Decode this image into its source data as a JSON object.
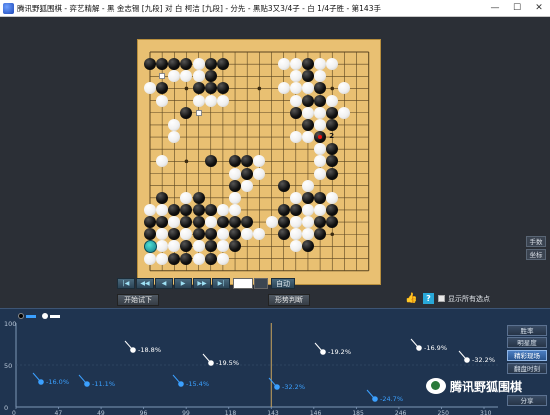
{
  "window": {
    "title": "腾讯野狐围棋 - 弈艺精解 - 黑 金志锡 [九段] 对 白 柯洁 [九段] - 分先 - 黑贴3又3/4子 - 白 1/4子胜 - 第143手",
    "minimize": "—",
    "maximize": "☐",
    "close": "✕"
  },
  "board": {
    "size": 19,
    "stones": [
      {
        "c": "b",
        "x": 0,
        "y": 1
      },
      {
        "c": "b",
        "x": 1,
        "y": 1
      },
      {
        "c": "b",
        "x": 2,
        "y": 1
      },
      {
        "c": "b",
        "x": 3,
        "y": 1
      },
      {
        "c": "w",
        "x": 4,
        "y": 1
      },
      {
        "c": "b",
        "x": 5,
        "y": 1
      },
      {
        "c": "b",
        "x": 6,
        "y": 1
      },
      {
        "c": "w",
        "x": 11,
        "y": 1
      },
      {
        "c": "w",
        "x": 12,
        "y": 1
      },
      {
        "c": "b",
        "x": 13,
        "y": 1
      },
      {
        "c": "w",
        "x": 14,
        "y": 1
      },
      {
        "c": "w",
        "x": 15,
        "y": 1
      },
      {
        "c": "w",
        "x": 2,
        "y": 2
      },
      {
        "c": "w",
        "x": 3,
        "y": 2
      },
      {
        "c": "w",
        "x": 4,
        "y": 2
      },
      {
        "c": "b",
        "x": 5,
        "y": 2
      },
      {
        "c": "w",
        "x": 12,
        "y": 2
      },
      {
        "c": "b",
        "x": 13,
        "y": 2
      },
      {
        "c": "w",
        "x": 14,
        "y": 2
      },
      {
        "c": "w",
        "x": 0,
        "y": 3
      },
      {
        "c": "b",
        "x": 1,
        "y": 3
      },
      {
        "c": "b",
        "x": 4,
        "y": 3
      },
      {
        "c": "b",
        "x": 5,
        "y": 3
      },
      {
        "c": "b",
        "x": 6,
        "y": 3
      },
      {
        "c": "w",
        "x": 11,
        "y": 3
      },
      {
        "c": "w",
        "x": 12,
        "y": 3
      },
      {
        "c": "w",
        "x": 13,
        "y": 3
      },
      {
        "c": "b",
        "x": 14,
        "y": 3
      },
      {
        "c": "w",
        "x": 16,
        "y": 3
      },
      {
        "c": "w",
        "x": 1,
        "y": 4
      },
      {
        "c": "w",
        "x": 4,
        "y": 4
      },
      {
        "c": "w",
        "x": 5,
        "y": 4
      },
      {
        "c": "w",
        "x": 6,
        "y": 4
      },
      {
        "c": "w",
        "x": 12,
        "y": 4
      },
      {
        "c": "b",
        "x": 13,
        "y": 4
      },
      {
        "c": "b",
        "x": 14,
        "y": 4
      },
      {
        "c": "w",
        "x": 15,
        "y": 4
      },
      {
        "c": "b",
        "x": 3,
        "y": 5
      },
      {
        "c": "b",
        "x": 12,
        "y": 5
      },
      {
        "c": "w",
        "x": 13,
        "y": 5
      },
      {
        "c": "w",
        "x": 14,
        "y": 5
      },
      {
        "c": "b",
        "x": 15,
        "y": 5
      },
      {
        "c": "w",
        "x": 16,
        "y": 5
      },
      {
        "c": "w",
        "x": 2,
        "y": 6
      },
      {
        "c": "b",
        "x": 13,
        "y": 6
      },
      {
        "c": "w",
        "x": 14,
        "y": 6
      },
      {
        "c": "b",
        "x": 15,
        "y": 6
      },
      {
        "c": "w",
        "x": 2,
        "y": 7
      },
      {
        "c": "w",
        "x": 12,
        "y": 7
      },
      {
        "c": "w",
        "x": 13,
        "y": 7
      },
      {
        "c": "b",
        "x": 14,
        "y": 7
      },
      {
        "c": "w",
        "x": 14,
        "y": 8
      },
      {
        "c": "b",
        "x": 15,
        "y": 8
      },
      {
        "c": "w",
        "x": 1,
        "y": 9
      },
      {
        "c": "b",
        "x": 5,
        "y": 9
      },
      {
        "c": "b",
        "x": 7,
        "y": 9
      },
      {
        "c": "b",
        "x": 8,
        "y": 9
      },
      {
        "c": "w",
        "x": 9,
        "y": 9
      },
      {
        "c": "w",
        "x": 14,
        "y": 9
      },
      {
        "c": "b",
        "x": 15,
        "y": 9
      },
      {
        "c": "w",
        "x": 7,
        "y": 10
      },
      {
        "c": "b",
        "x": 8,
        "y": 10
      },
      {
        "c": "w",
        "x": 9,
        "y": 10
      },
      {
        "c": "w",
        "x": 14,
        "y": 10
      },
      {
        "c": "b",
        "x": 15,
        "y": 10
      },
      {
        "c": "b",
        "x": 7,
        "y": 11
      },
      {
        "c": "w",
        "x": 8,
        "y": 11
      },
      {
        "c": "b",
        "x": 11,
        "y": 11
      },
      {
        "c": "w",
        "x": 13,
        "y": 11
      },
      {
        "c": "b",
        "x": 1,
        "y": 12
      },
      {
        "c": "w",
        "x": 3,
        "y": 12
      },
      {
        "c": "b",
        "x": 4,
        "y": 12
      },
      {
        "c": "w",
        "x": 7,
        "y": 12
      },
      {
        "c": "w",
        "x": 12,
        "y": 12
      },
      {
        "c": "b",
        "x": 13,
        "y": 12
      },
      {
        "c": "b",
        "x": 14,
        "y": 12
      },
      {
        "c": "w",
        "x": 15,
        "y": 12
      },
      {
        "c": "w",
        "x": 0,
        "y": 13
      },
      {
        "c": "w",
        "x": 1,
        "y": 13
      },
      {
        "c": "b",
        "x": 2,
        "y": 13
      },
      {
        "c": "b",
        "x": 3,
        "y": 13
      },
      {
        "c": "b",
        "x": 4,
        "y": 13
      },
      {
        "c": "b",
        "x": 5,
        "y": 13
      },
      {
        "c": "w",
        "x": 6,
        "y": 13
      },
      {
        "c": "w",
        "x": 7,
        "y": 13
      },
      {
        "c": "b",
        "x": 11,
        "y": 13
      },
      {
        "c": "b",
        "x": 12,
        "y": 13
      },
      {
        "c": "w",
        "x": 13,
        "y": 13
      },
      {
        "c": "w",
        "x": 14,
        "y": 13
      },
      {
        "c": "b",
        "x": 15,
        "y": 13
      },
      {
        "c": "b",
        "x": 0,
        "y": 14
      },
      {
        "c": "b",
        "x": 1,
        "y": 14
      },
      {
        "c": "w",
        "x": 2,
        "y": 14
      },
      {
        "c": "b",
        "x": 3,
        "y": 14
      },
      {
        "c": "b",
        "x": 4,
        "y": 14
      },
      {
        "c": "w",
        "x": 5,
        "y": 14
      },
      {
        "c": "b",
        "x": 6,
        "y": 14
      },
      {
        "c": "b",
        "x": 7,
        "y": 14
      },
      {
        "c": "b",
        "x": 8,
        "y": 14
      },
      {
        "c": "w",
        "x": 10,
        "y": 14
      },
      {
        "c": "b",
        "x": 11,
        "y": 14
      },
      {
        "c": "w",
        "x": 12,
        "y": 14
      },
      {
        "c": "w",
        "x": 13,
        "y": 14
      },
      {
        "c": "b",
        "x": 14,
        "y": 14
      },
      {
        "c": "b",
        "x": 15,
        "y": 14
      },
      {
        "c": "b",
        "x": 0,
        "y": 15
      },
      {
        "c": "w",
        "x": 1,
        "y": 15
      },
      {
        "c": "b",
        "x": 2,
        "y": 15
      },
      {
        "c": "w",
        "x": 3,
        "y": 15
      },
      {
        "c": "b",
        "x": 4,
        "y": 15
      },
      {
        "c": "b",
        "x": 5,
        "y": 15
      },
      {
        "c": "w",
        "x": 6,
        "y": 15
      },
      {
        "c": "b",
        "x": 7,
        "y": 15
      },
      {
        "c": "w",
        "x": 8,
        "y": 15
      },
      {
        "c": "w",
        "x": 9,
        "y": 15
      },
      {
        "c": "b",
        "x": 11,
        "y": 15
      },
      {
        "c": "w",
        "x": 12,
        "y": 15
      },
      {
        "c": "w",
        "x": 13,
        "y": 15
      },
      {
        "c": "b",
        "x": 14,
        "y": 15
      },
      {
        "c": "w",
        "x": 1,
        "y": 16
      },
      {
        "c": "w",
        "x": 2,
        "y": 16
      },
      {
        "c": "b",
        "x": 3,
        "y": 16
      },
      {
        "c": "w",
        "x": 4,
        "y": 16
      },
      {
        "c": "b",
        "x": 5,
        "y": 16
      },
      {
        "c": "w",
        "x": 6,
        "y": 16
      },
      {
        "c": "b",
        "x": 7,
        "y": 16
      },
      {
        "c": "w",
        "x": 12,
        "y": 16
      },
      {
        "c": "b",
        "x": 13,
        "y": 16
      },
      {
        "c": "w",
        "x": 0,
        "y": 17
      },
      {
        "c": "w",
        "x": 1,
        "y": 17
      },
      {
        "c": "b",
        "x": 2,
        "y": 17
      },
      {
        "c": "b",
        "x": 3,
        "y": 17
      },
      {
        "c": "w",
        "x": 4,
        "y": 17
      },
      {
        "c": "b",
        "x": 5,
        "y": 17
      },
      {
        "c": "w",
        "x": 6,
        "y": 17
      }
    ],
    "markers": [
      {
        "x": 1,
        "y": 2
      },
      {
        "x": 4,
        "y": 5
      }
    ],
    "last_move": {
      "x": 0,
      "y": 16
    },
    "red_dot": {
      "x": 14,
      "y": 7
    },
    "labels": [
      {
        "text": "2",
        "x": 15,
        "y": 7
      }
    ]
  },
  "side_buttons": {
    "hands": "手数",
    "coords": "坐标"
  },
  "nav": {
    "first": "|◀",
    "back10": "◀◀",
    "back": "◀",
    "forward": "▶",
    "forward10": "▶▶",
    "last": "▶|",
    "auto": "自动"
  },
  "toolbar": {
    "trial": "开始试下",
    "judge": "形势判断",
    "thumb": "👍",
    "help": "?",
    "show_all": "显示所有选点"
  },
  "chart": {
    "y_ticks": [
      "100",
      "50",
      "0"
    ],
    "x_ticks": [
      "0",
      "47",
      "49",
      "96",
      "99",
      "118",
      "143",
      "146",
      "185",
      "246",
      "250",
      "310"
    ],
    "buttons": [
      "胜率",
      "明星度",
      "精彩现场",
      "翻盘时刻",
      "分享"
    ],
    "active_button": 2,
    "current_move": 143,
    "labels": [
      "-18.8%",
      "-19.5%",
      "-19.2%",
      "-16.9%",
      "-32.2%",
      "-16.0%",
      "-11.1%",
      "-15.4%",
      "-32.2%",
      "-24.7%"
    ],
    "marker_colors": {
      "white": "#ffffff",
      "blue": "#3ba0ff",
      "axis": "#7e97b6",
      "current": "#c9a45c"
    }
  },
  "watermark": "腾讯野狐围棋"
}
